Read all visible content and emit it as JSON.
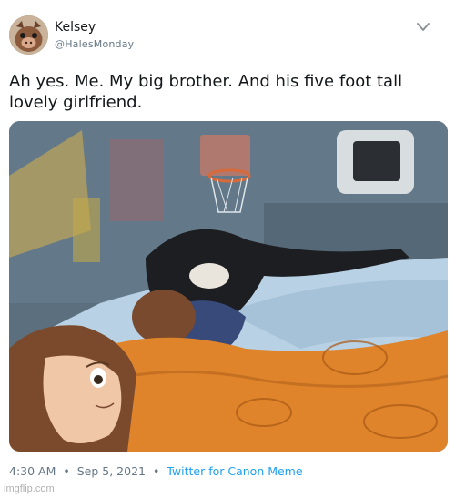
{
  "tweet": {
    "display_name": "Kelsey",
    "handle": "@HalesMonday",
    "text": "Ah yes. Me. My big brother. And his five foot tall lovely girlfriend.",
    "timestamp_time": "4:30 AM",
    "timestamp_date": "Sep 5, 2021",
    "source": "Twitter for Canon Meme",
    "separator": "•"
  },
  "icons": {
    "more": "chevron-down-icon",
    "avatar": "avatar"
  },
  "watermark": "imgflip.com",
  "colors": {
    "link": "#1da1f2",
    "secondary_text": "#657786",
    "primary_text": "#14171a",
    "blanket_orange": "#e0862b",
    "sheet_blue": "#bcd4e6",
    "wall": "#5f7383"
  }
}
